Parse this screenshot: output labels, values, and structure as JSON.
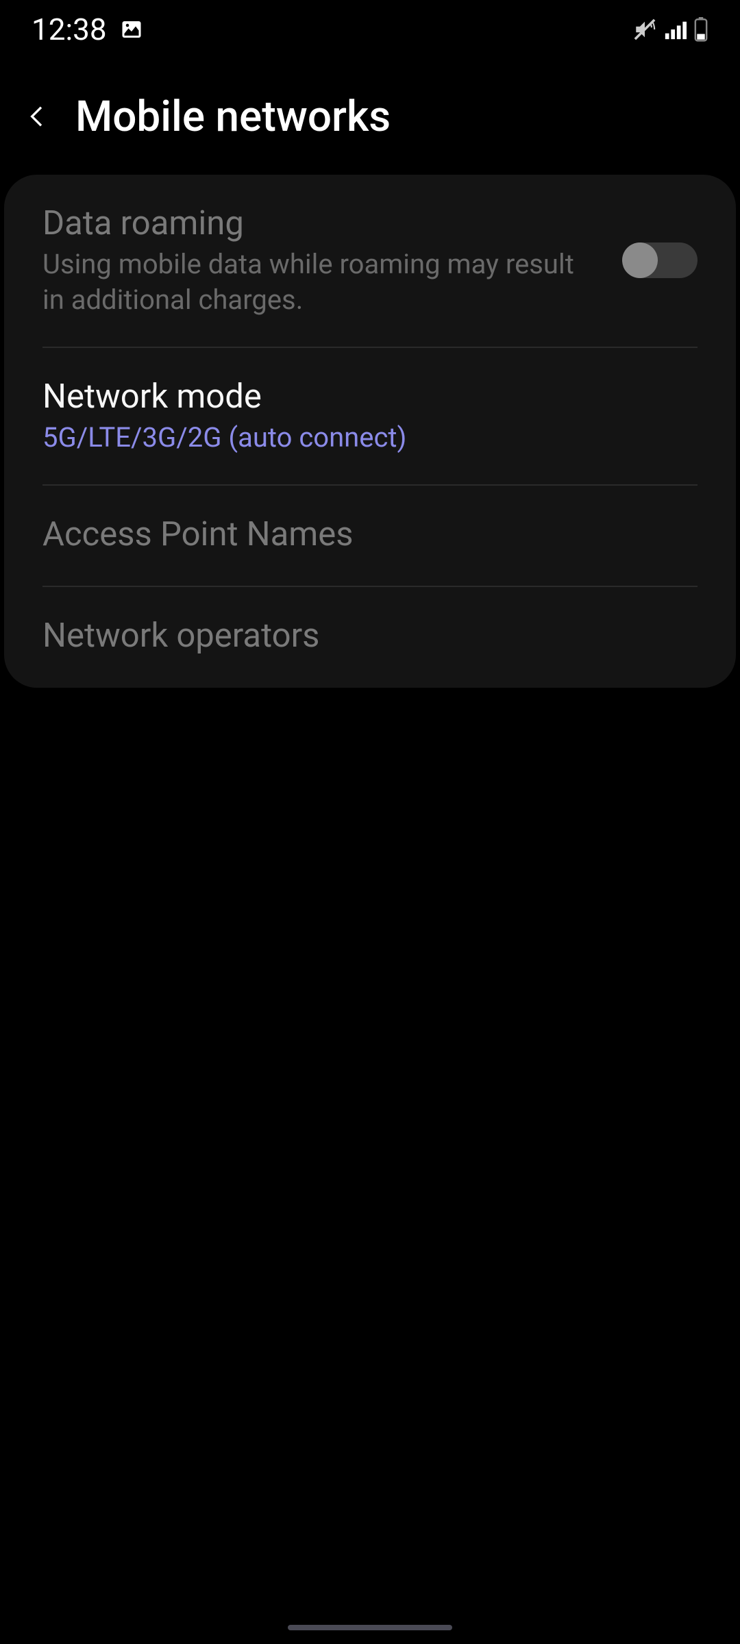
{
  "status_bar": {
    "time": "12:38"
  },
  "header": {
    "title": "Mobile networks"
  },
  "settings": {
    "data_roaming": {
      "title": "Data roaming",
      "subtitle": "Using mobile data while roaming may result in additional charges.",
      "toggle_on": false
    },
    "network_mode": {
      "title": "Network mode",
      "subtitle": "5G/LTE/3G/2G (auto connect)"
    },
    "apn": {
      "title": "Access Point Names"
    },
    "network_operators": {
      "title": "Network operators"
    }
  }
}
